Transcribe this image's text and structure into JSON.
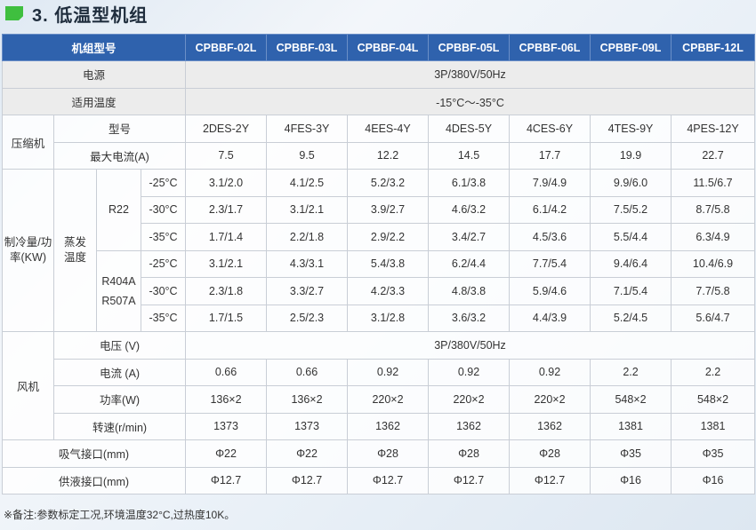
{
  "heading": {
    "title": "3. 低温型机组"
  },
  "table": {
    "corner": "机组型号",
    "models": [
      "CPBBF-02L",
      "CPBBF-03L",
      "CPBBF-04L",
      "CPBBF-05L",
      "CPBBF-06L",
      "CPBBF-09L",
      "CPBBF-12L"
    ],
    "power_supply": {
      "label": "电源",
      "value": "3P/380V/50Hz"
    },
    "applicable_temp": {
      "label": "适用温度",
      "value": "-15°C〜-35°C"
    },
    "compressor": {
      "group": "压缩机",
      "model_label": "型号",
      "models": [
        "2DES-2Y",
        "4FES-3Y",
        "4EES-4Y",
        "4DES-5Y",
        "4CES-6Y",
        "4TES-9Y",
        "4PES-12Y"
      ],
      "current_label": "最大电流(A)",
      "currents": [
        "7.5",
        "9.5",
        "12.2",
        "14.5",
        "17.7",
        "19.9",
        "22.7"
      ]
    },
    "cooling": {
      "group": "制冷量/功率(KW)",
      "evap_label": "蒸发温度",
      "r22_label": "R22",
      "r404_label_1": "R404A",
      "r404_label_2": "R507A",
      "r22_rows": [
        {
          "temp": "-25°C",
          "values": [
            "3.1/2.0",
            "4.1/2.5",
            "5.2/3.2",
            "6.1/3.8",
            "7.9/4.9",
            "9.9/6.0",
            "11.5/6.7"
          ]
        },
        {
          "temp": "-30°C",
          "values": [
            "2.3/1.7",
            "3.1/2.1",
            "3.9/2.7",
            "4.6/3.2",
            "6.1/4.2",
            "7.5/5.2",
            "8.7/5.8"
          ]
        },
        {
          "temp": "-35°C",
          "values": [
            "1.7/1.4",
            "2.2/1.8",
            "2.9/2.2",
            "3.4/2.7",
            "4.5/3.6",
            "5.5/4.4",
            "6.3/4.9"
          ]
        }
      ],
      "r404_rows": [
        {
          "temp": "-25°C",
          "values": [
            "3.1/2.1",
            "4.3/3.1",
            "5.4/3.8",
            "6.2/4.4",
            "7.7/5.4",
            "9.4/6.4",
            "10.4/6.9"
          ]
        },
        {
          "temp": "-30°C",
          "values": [
            "2.3/1.8",
            "3.3/2.7",
            "4.2/3.3",
            "4.8/3.8",
            "5.9/4.6",
            "7.1/5.4",
            "7.7/5.8"
          ]
        },
        {
          "temp": "-35°C",
          "values": [
            "1.7/1.5",
            "2.5/2.3",
            "3.1/2.8",
            "3.6/3.2",
            "4.4/3.9",
            "5.2/4.5",
            "5.6/4.7"
          ]
        }
      ]
    },
    "fan": {
      "group": "风机",
      "voltage_label": "电压 (V)",
      "voltage_value": "3P/380V/50Hz",
      "current_label": "电流 (A)",
      "currents": [
        "0.66",
        "0.66",
        "0.92",
        "0.92",
        "0.92",
        "2.2",
        "2.2"
      ],
      "power_label": "功率(W)",
      "powers": [
        "136×2",
        "136×2",
        "220×2",
        "220×2",
        "220×2",
        "548×2",
        "548×2"
      ],
      "speed_label": "转速(r/min)",
      "speeds": [
        "1373",
        "1373",
        "1362",
        "1362",
        "1362",
        "1381",
        "1381"
      ]
    },
    "suction": {
      "label": "吸气接口(mm)",
      "values": [
        "Φ22",
        "Φ22",
        "Φ28",
        "Φ28",
        "Φ28",
        "Φ35",
        "Φ35"
      ]
    },
    "liquid": {
      "label": "供液接口(mm)",
      "values": [
        "Φ12.7",
        "Φ12.7",
        "Φ12.7",
        "Φ12.7",
        "Φ12.7",
        "Φ16",
        "Φ16"
      ]
    }
  },
  "note": "※备注:参数标定工况,环境温度32°C,过热度10K。"
}
